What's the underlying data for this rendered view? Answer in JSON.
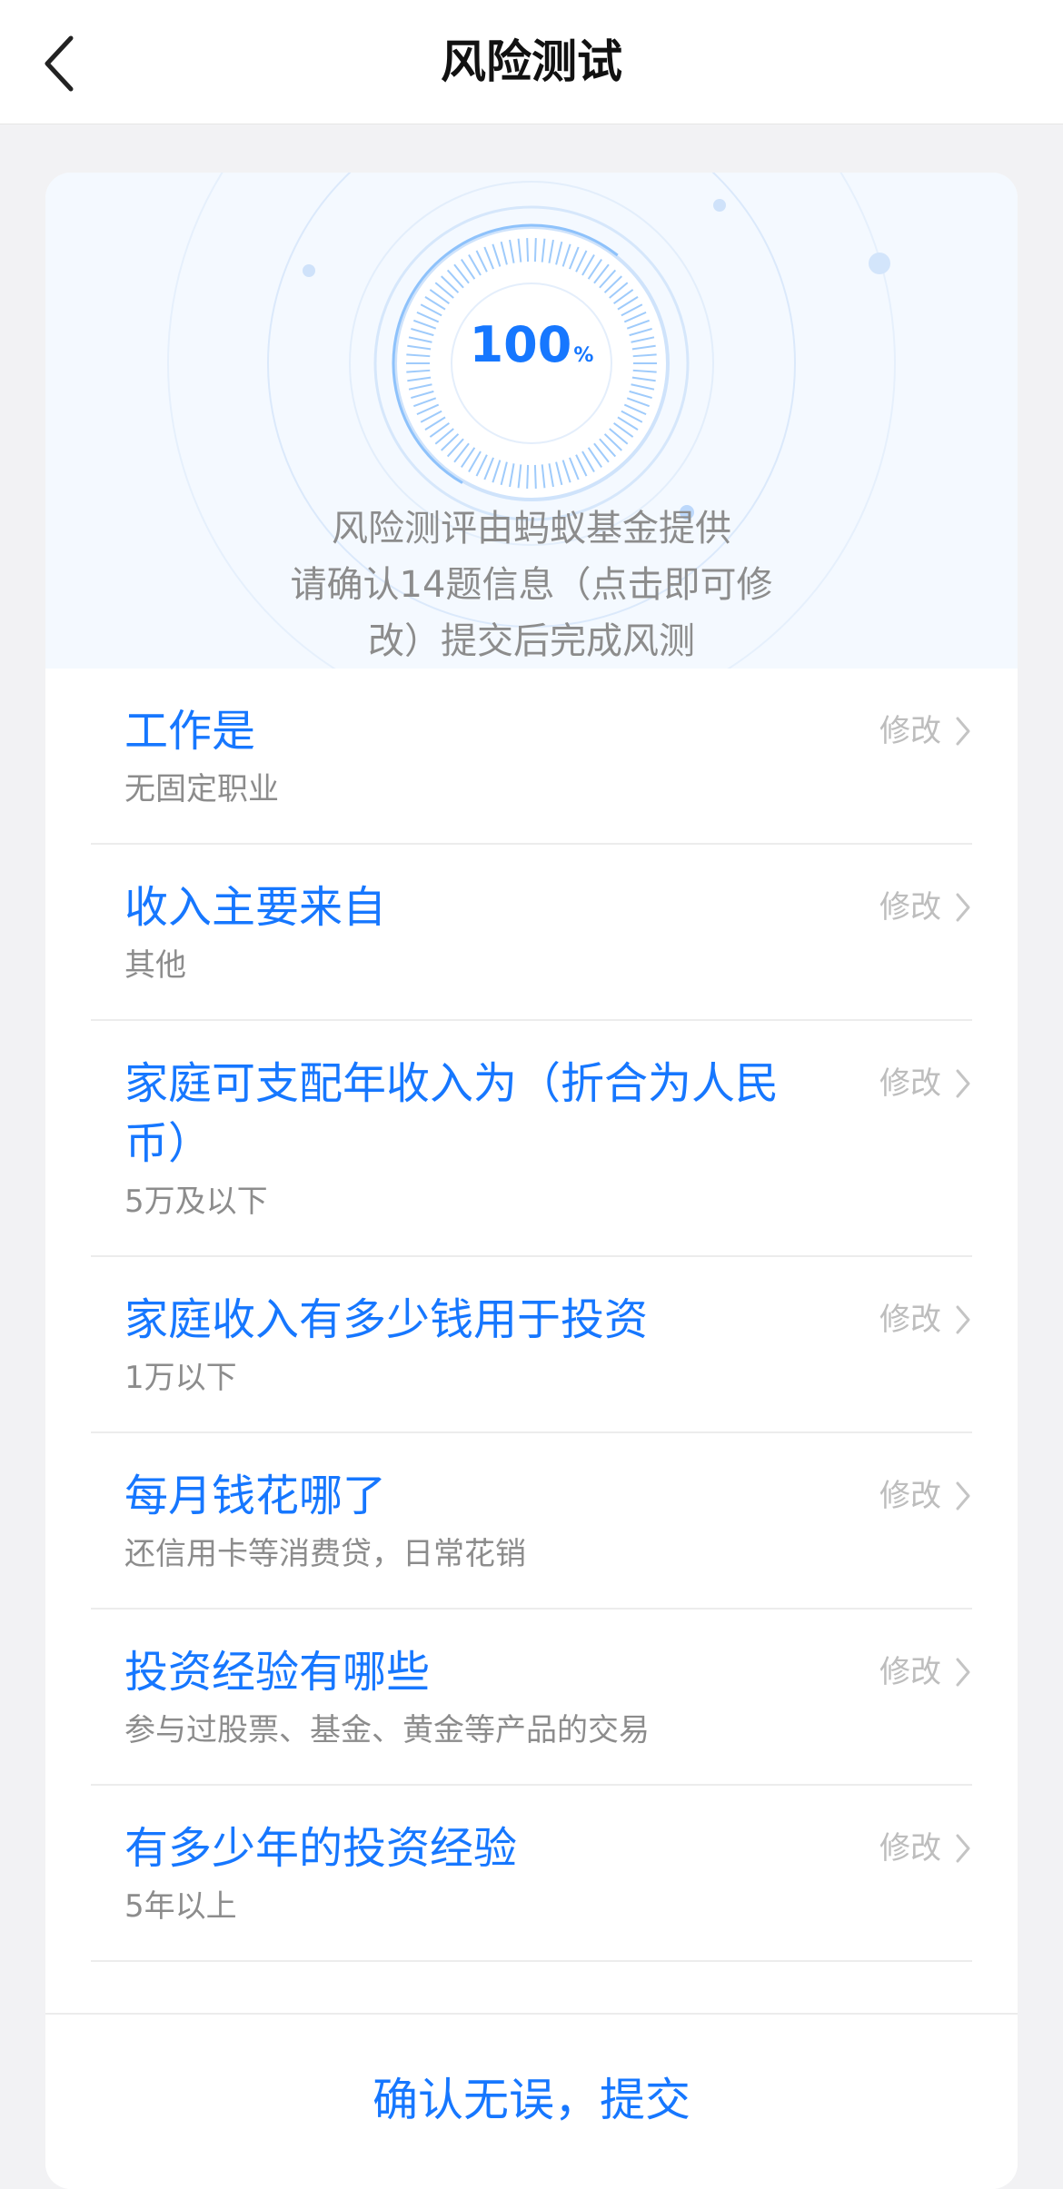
{
  "header": {
    "title": "风险测试"
  },
  "progress": {
    "value": "100",
    "unit": "%",
    "fraction": 1.0
  },
  "hero": {
    "line1": "风险测评由蚂蚁基金提供",
    "line2": "请确认14题信息（点击即可修",
    "line3": "改）提交后完成风测"
  },
  "questions": [
    {
      "q": "工作是",
      "a": "无固定职业",
      "edit": "修改"
    },
    {
      "q": "收入主要来自",
      "a": "其他",
      "edit": "修改"
    },
    {
      "q": "家庭可支配年收入为（折合为人民币）",
      "a": "5万及以下",
      "edit": "修改"
    },
    {
      "q": "家庭收入有多少钱用于投资",
      "a": "1万以下",
      "edit": "修改"
    },
    {
      "q": "每月钱花哪了",
      "a": "还信用卡等消费贷，日常花销",
      "edit": "修改"
    },
    {
      "q": "投资经验有哪些",
      "a": "参与过股票、基金、黄金等产品的交易",
      "edit": "修改"
    },
    {
      "q": "有多少年的投资经验",
      "a": "5年以上",
      "edit": "修改"
    }
  ],
  "footer": {
    "submit_label": "确认无误，提交"
  },
  "colors": {
    "accent": "#1677ff",
    "muted": "#8c8c8c",
    "edit": "#bdbdbd"
  },
  "icons": {
    "back": "chevron-left-icon",
    "edit": "chevron-right-icon"
  }
}
